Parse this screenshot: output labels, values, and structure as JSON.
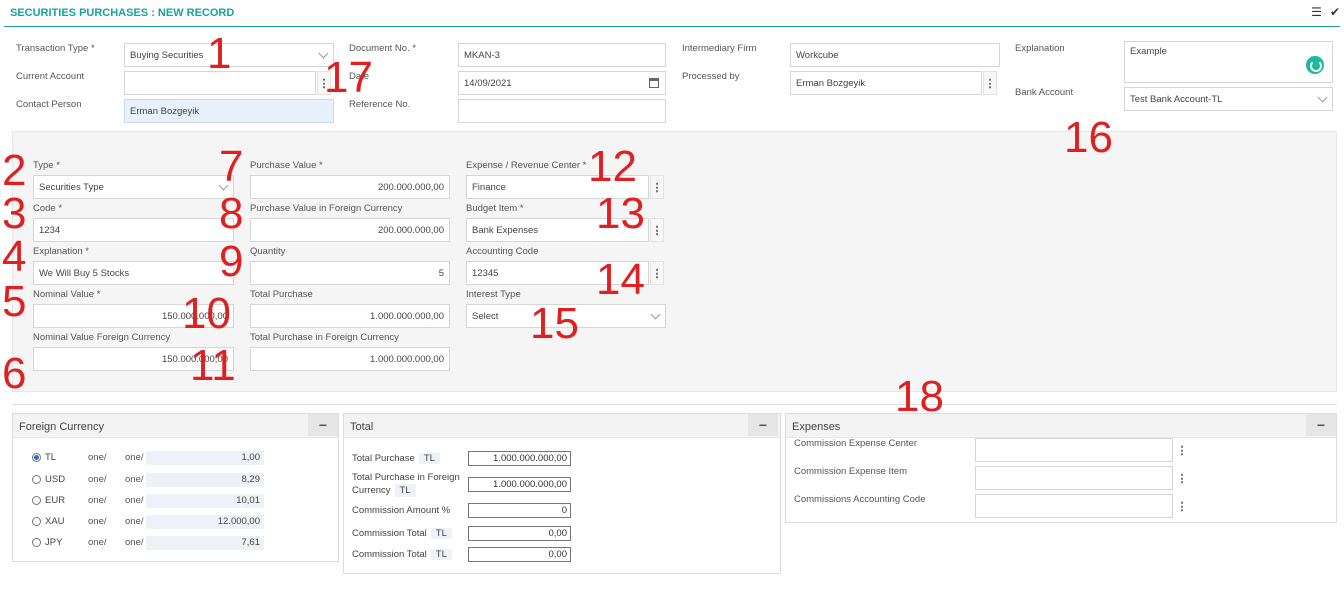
{
  "header": {
    "title": "SECURITIES PURCHASES : NEW RECORD"
  },
  "form": {
    "transaction_type_label": "Transaction Type *",
    "transaction_type_value": "Buying Securities",
    "current_account_label": "Current Account",
    "contact_person_label": "Contact Person",
    "contact_person_value": "Erman Bozgeyik",
    "document_no_label": "Document No. *",
    "document_no_value": "MKAN-3",
    "date_label": "Date",
    "date_value": "14/09/2021",
    "reference_no_label": "Reference No.",
    "intermediary_firm_label": "Intermediary Firm",
    "intermediary_firm_value": "Workcube",
    "processed_by_label": "Processed by",
    "processed_by_value": "Erman Bozgeyik",
    "explanation_label": "Explanation",
    "explanation_value": "Example",
    "bank_account_label": "Bank Account",
    "bank_account_value": "Test Bank Account-TL"
  },
  "details": {
    "type_label": "Type *",
    "type_value": "Securities Type",
    "code_label": "Code *",
    "code_value": "1234",
    "explanation_label": "Explanation *",
    "explanation_value": "We Will Buy 5 Stocks",
    "nominal_label": "Nominal Value *",
    "nominal_value": "150.000.000,00",
    "nominal_fc_label": "Nominal Value Foreign Currency",
    "nominal_fc_value": "150.000.000,00",
    "purchase_label": "Purchase Value *",
    "purchase_value": "200.000.000,00",
    "purchase_fc_label": "Purchase Value in Foreign Currency",
    "purchase_fc_value": "200.000.000,00",
    "quantity_label": "Quantity",
    "quantity_value": "5",
    "total_purchase_label": "Total Purchase",
    "total_purchase_value": "1.000.000.000,00",
    "total_purchase_fc_label": "Total Purchase in Foreign Currency",
    "total_purchase_fc_value": "1.000.000.000,00",
    "expense_center_label": "Expense / Revenue Center *",
    "expense_center_value": "Finance",
    "budget_item_label": "Budget Item *",
    "budget_item_value": "Bank Expenses",
    "accounting_code_label": "Accounting Code",
    "accounting_code_value": "12345",
    "interest_type_label": "Interest Type",
    "interest_type_value": "Select"
  },
  "annotations": {
    "n1": "1",
    "n2": "2",
    "n3": "3",
    "n4": "4",
    "n5": "5",
    "n6": "6",
    "n7": "7",
    "n8": "8",
    "n9": "9",
    "n10": "10",
    "n11": "11",
    "n12": "12",
    "n13": "13",
    "n14": "14",
    "n15": "15",
    "n16": "16",
    "n17": "17",
    "n18": "18"
  },
  "foreign_currency": {
    "title": "Foreign Currency",
    "rows": [
      {
        "code": "TL",
        "a": "one/",
        "b": "one/",
        "value": "1,00"
      },
      {
        "code": "USD",
        "a": "one/",
        "b": "one/",
        "value": "8,29"
      },
      {
        "code": "EUR",
        "a": "one/",
        "b": "one/",
        "value": "10,01"
      },
      {
        "code": "XAU",
        "a": "one/",
        "b": "one/",
        "value": "12.000,00"
      },
      {
        "code": "JPY",
        "a": "one/",
        "b": "one/",
        "value": "7,61"
      }
    ]
  },
  "total": {
    "title": "Total",
    "total_purchase_label": "Total Purchase",
    "total_purchase_cur": "TL",
    "total_purchase_value": "1.000.000.000,00",
    "total_purchase_fc_label1": "Total Purchase in Foreign",
    "total_purchase_fc_label2": "Currency",
    "total_purchase_fc_cur": "TL",
    "total_purchase_fc_value": "1.000.000.000,00",
    "commission_amount_label": "Commission Amount %",
    "commission_amount_value": "0",
    "commission_total1_label": "Commission Total",
    "commission_total1_cur": "TL",
    "commission_total1_value": "0,00",
    "commission_total2_label": "Commission Total",
    "commission_total2_cur": "TL",
    "commission_total2_value": "0,00"
  },
  "expenses": {
    "title": "Expenses",
    "center_label": "Commission Expense Center",
    "item_label": "Commission Expense Item",
    "code_label": "Commissions Accounting Code"
  },
  "colors": {
    "accent": "#1aa398",
    "annotation": "#e02020"
  }
}
